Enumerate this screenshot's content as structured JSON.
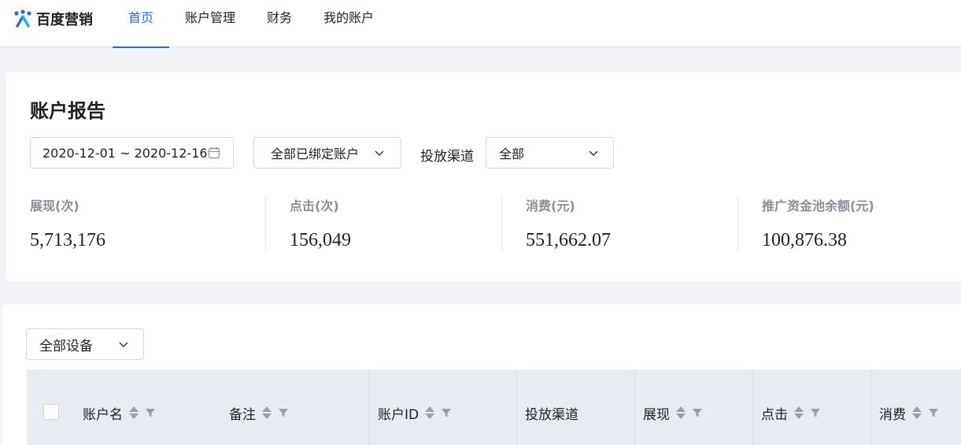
{
  "brand": {
    "name": "百度营销",
    "accent": "#2d66db"
  },
  "nav": {
    "items": [
      "首页",
      "账户管理",
      "财务",
      "我的账户"
    ],
    "active": 0
  },
  "report": {
    "title": "账户报告",
    "date_range": "2020-12-01 ~ 2020-12-16",
    "account_select": "全部已绑定账户",
    "channel_label": "投放渠道",
    "channel_select": "全部",
    "metrics": [
      {
        "label": "展现(次)",
        "value": "5,713,176"
      },
      {
        "label": "点击(次)",
        "value": "156,049"
      },
      {
        "label": "消费(元)",
        "value": "551,662.07"
      },
      {
        "label": "推广资金池余额(元)",
        "value": "100,876.38"
      }
    ]
  },
  "table": {
    "device_select": "全部设备",
    "columns": [
      "账户名",
      "备注",
      "账户ID",
      "投放渠道",
      "展现",
      "点击",
      "消费"
    ]
  },
  "icons": [
    "calendar-icon",
    "chevron-down-icon",
    "sort-icon",
    "filter-icon",
    "baidu-logo-icon"
  ]
}
